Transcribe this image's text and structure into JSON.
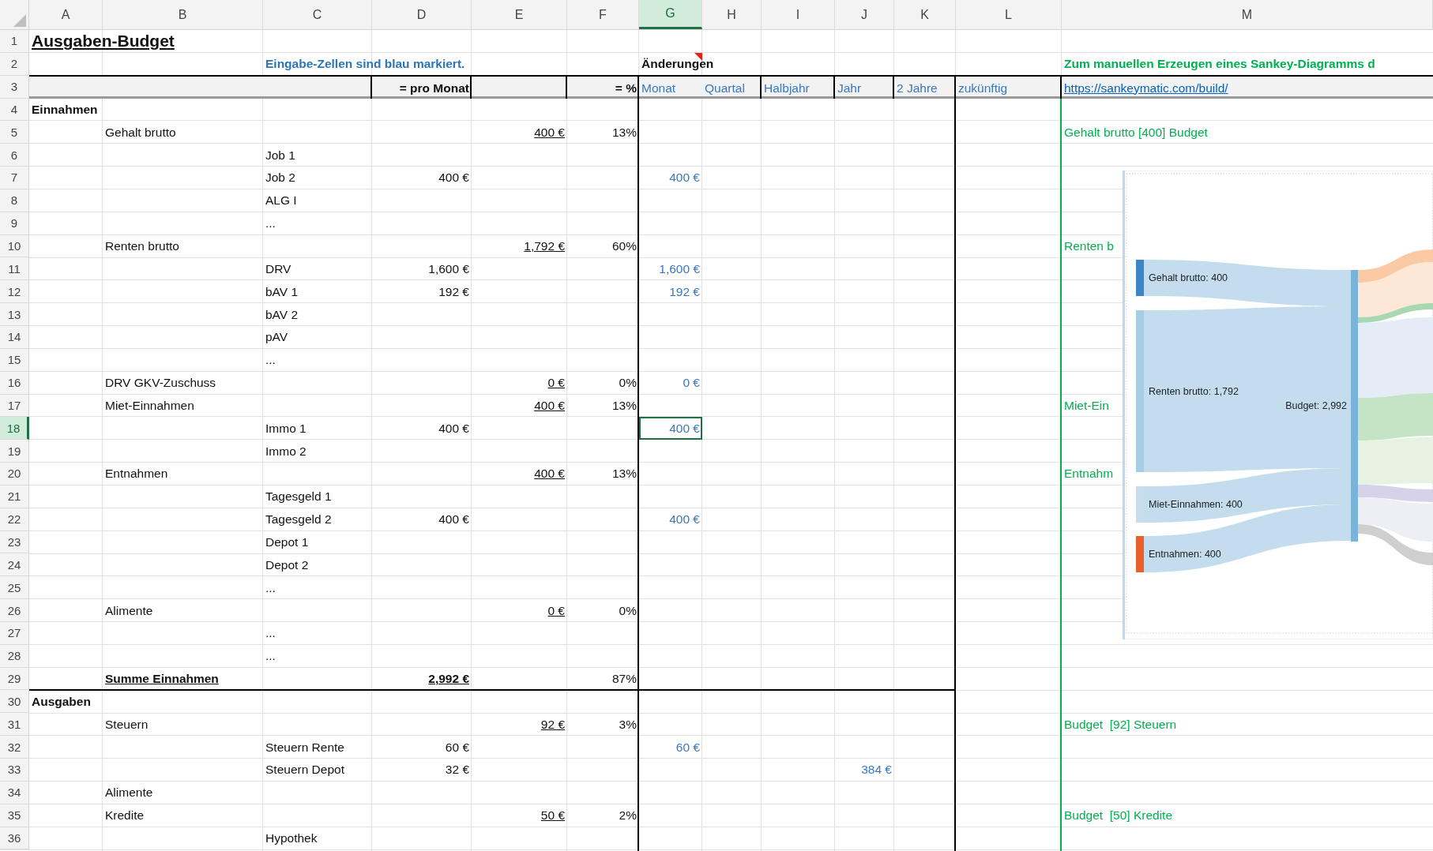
{
  "columns": [
    {
      "label": "A",
      "selected": false
    },
    {
      "label": "B",
      "selected": false
    },
    {
      "label": "C",
      "selected": false
    },
    {
      "label": "D",
      "selected": false
    },
    {
      "label": "E",
      "selected": false
    },
    {
      "label": "F",
      "selected": false
    },
    {
      "label": "G",
      "selected": true
    },
    {
      "label": "H",
      "selected": false
    },
    {
      "label": "I",
      "selected": false
    },
    {
      "label": "J",
      "selected": false
    },
    {
      "label": "K",
      "selected": false
    },
    {
      "label": "L",
      "selected": false
    },
    {
      "label": "M",
      "selected": false
    }
  ],
  "rows": [
    {
      "label": "1",
      "selected": false,
      "cells": {
        "A": {
          "kind": "title",
          "text": "Ausgaben-Budget",
          "selected": false
        }
      }
    },
    {
      "label": "2",
      "selected": false,
      "cells": {
        "C": {
          "kind": "note",
          "text": "Eingabe-Zellen sind blau markiert.",
          "selected": false
        },
        "G": {
          "kind": "heading",
          "text": "Änderungen",
          "selected": false,
          "comment": true
        },
        "M": {
          "kind": "greenbold",
          "text": "Zum manuellen Erzeugen eines Sankey-Diagramms d",
          "selected": false
        }
      }
    },
    {
      "label": "3",
      "selected": false,
      "cells": {
        "D": {
          "kind": "header",
          "text": "= pro Monat",
          "selected": false
        },
        "F": {
          "kind": "header",
          "text": "= %",
          "selected": false
        },
        "G": {
          "kind": "period",
          "text": "Monat",
          "selected": false
        },
        "H": {
          "kind": "period",
          "text": "Quartal",
          "selected": false
        },
        "I": {
          "kind": "period",
          "text": "Halbjahr",
          "selected": false
        },
        "J": {
          "kind": "period",
          "text": "Jahr",
          "selected": false
        },
        "K": {
          "kind": "period",
          "text": "2 Jahre",
          "selected": false
        },
        "L": {
          "kind": "period",
          "text": "zukünftig",
          "selected": false
        },
        "M": {
          "kind": "link",
          "text": "https://sankeymatic.com/build/",
          "selected": false
        }
      }
    },
    {
      "label": "4",
      "selected": false,
      "cells": {
        "A": {
          "kind": "heading",
          "text": "Einnahmen",
          "selected": false
        }
      }
    },
    {
      "label": "5",
      "selected": false,
      "cells": {
        "B": {
          "kind": "label",
          "text": "Gehalt brutto",
          "selected": false
        },
        "E": {
          "kind": "sum",
          "text": "400 €",
          "selected": false
        },
        "F": {
          "kind": "pct",
          "text": "13%",
          "selected": false
        },
        "M": {
          "kind": "green",
          "text": "Gehalt brutto [400] Budget",
          "selected": false
        }
      }
    },
    {
      "label": "6",
      "selected": false,
      "cells": {
        "C": {
          "kind": "label",
          "text": "Job 1",
          "selected": false
        }
      }
    },
    {
      "label": "7",
      "selected": false,
      "cells": {
        "C": {
          "kind": "label",
          "text": "Job 2",
          "selected": false
        },
        "D": {
          "kind": "amount",
          "text": "400 €",
          "selected": false
        },
        "G": {
          "kind": "input",
          "text": "400 €",
          "selected": false
        }
      }
    },
    {
      "label": "8",
      "selected": false,
      "cells": {
        "C": {
          "kind": "label",
          "text": "ALG I",
          "selected": false
        }
      }
    },
    {
      "label": "9",
      "selected": false,
      "cells": {
        "C": {
          "kind": "label",
          "text": "...",
          "selected": false
        }
      }
    },
    {
      "label": "10",
      "selected": false,
      "cells": {
        "B": {
          "kind": "label",
          "text": "Renten brutto",
          "selected": false
        },
        "E": {
          "kind": "sum",
          "text": "1,792 €",
          "selected": false
        },
        "F": {
          "kind": "pct",
          "text": "60%",
          "selected": false
        },
        "M": {
          "kind": "green",
          "text": "Renten b",
          "selected": false
        }
      }
    },
    {
      "label": "11",
      "selected": false,
      "cells": {
        "C": {
          "kind": "label",
          "text": "DRV",
          "selected": false
        },
        "D": {
          "kind": "amount",
          "text": "1,600 €",
          "selected": false
        },
        "G": {
          "kind": "input",
          "text": "1,600 €",
          "selected": false
        }
      }
    },
    {
      "label": "12",
      "selected": false,
      "cells": {
        "C": {
          "kind": "label",
          "text": "bAV 1",
          "selected": false
        },
        "D": {
          "kind": "amount",
          "text": "192 €",
          "selected": false
        },
        "G": {
          "kind": "input",
          "text": "192 €",
          "selected": false
        }
      }
    },
    {
      "label": "13",
      "selected": false,
      "cells": {
        "C": {
          "kind": "label",
          "text": "bAV 2",
          "selected": false
        }
      }
    },
    {
      "label": "14",
      "selected": false,
      "cells": {
        "C": {
          "kind": "label",
          "text": "pAV",
          "selected": false
        }
      }
    },
    {
      "label": "15",
      "selected": false,
      "cells": {
        "C": {
          "kind": "label",
          "text": "...",
          "selected": false
        }
      }
    },
    {
      "label": "16",
      "selected": false,
      "cells": {
        "B": {
          "kind": "label",
          "text": "DRV GKV-Zuschuss",
          "selected": false
        },
        "E": {
          "kind": "sum",
          "text": "0 €",
          "selected": false
        },
        "F": {
          "kind": "pct",
          "text": "0%",
          "selected": false
        },
        "G": {
          "kind": "input",
          "text": "0 €",
          "selected": false
        }
      }
    },
    {
      "label": "17",
      "selected": false,
      "cells": {
        "B": {
          "kind": "label",
          "text": "Miet-Einnahmen",
          "selected": false
        },
        "E": {
          "kind": "sum",
          "text": "400 €",
          "selected": false
        },
        "F": {
          "kind": "pct",
          "text": "13%",
          "selected": false
        },
        "M": {
          "kind": "green",
          "text": "Miet-Ein",
          "selected": false
        }
      }
    },
    {
      "label": "18",
      "selected": true,
      "cells": {
        "C": {
          "kind": "label",
          "text": "Immo 1",
          "selected": false
        },
        "D": {
          "kind": "amount",
          "text": "400 €",
          "selected": false
        },
        "G": {
          "kind": "input",
          "text": "400 €",
          "selected": true
        }
      }
    },
    {
      "label": "19",
      "selected": false,
      "cells": {
        "C": {
          "kind": "label",
          "text": "Immo 2",
          "selected": false
        }
      }
    },
    {
      "label": "20",
      "selected": false,
      "cells": {
        "B": {
          "kind": "label",
          "text": "Entnahmen",
          "selected": false
        },
        "E": {
          "kind": "sum",
          "text": "400 €",
          "selected": false
        },
        "F": {
          "kind": "pct",
          "text": "13%",
          "selected": false
        },
        "M": {
          "kind": "green",
          "text": "Entnahm",
          "selected": false
        }
      }
    },
    {
      "label": "21",
      "selected": false,
      "cells": {
        "C": {
          "kind": "label",
          "text": "Tagesgeld 1",
          "selected": false
        }
      }
    },
    {
      "label": "22",
      "selected": false,
      "cells": {
        "C": {
          "kind": "label",
          "text": "Tagesgeld 2",
          "selected": false
        },
        "D": {
          "kind": "amount",
          "text": "400 €",
          "selected": false
        },
        "G": {
          "kind": "input",
          "text": "400 €",
          "selected": false
        }
      }
    },
    {
      "label": "23",
      "selected": false,
      "cells": {
        "C": {
          "kind": "label",
          "text": "Depot 1",
          "selected": false
        }
      }
    },
    {
      "label": "24",
      "selected": false,
      "cells": {
        "C": {
          "kind": "label",
          "text": "Depot 2",
          "selected": false
        }
      }
    },
    {
      "label": "25",
      "selected": false,
      "cells": {
        "C": {
          "kind": "label",
          "text": "...",
          "selected": false
        }
      }
    },
    {
      "label": "26",
      "selected": false,
      "cells": {
        "B": {
          "kind": "label",
          "text": "Alimente",
          "selected": false
        },
        "E": {
          "kind": "sum",
          "text": "0 €",
          "selected": false
        },
        "F": {
          "kind": "pct",
          "text": "0%",
          "selected": false
        }
      }
    },
    {
      "label": "27",
      "selected": false,
      "cells": {
        "C": {
          "kind": "label",
          "text": "...",
          "selected": false
        }
      }
    },
    {
      "label": "28",
      "selected": false,
      "cells": {
        "C": {
          "kind": "label",
          "text": "...",
          "selected": false
        }
      }
    },
    {
      "label": "29",
      "selected": false,
      "cells": {
        "B": {
          "kind": "totallabel",
          "text": "Summe Einnahmen",
          "selected": false
        },
        "D": {
          "kind": "total",
          "text": "2,992 €",
          "selected": false
        },
        "F": {
          "kind": "pct",
          "text": "87%",
          "selected": false
        }
      }
    },
    {
      "label": "30",
      "selected": false,
      "cells": {
        "A": {
          "kind": "heading",
          "text": "Ausgaben",
          "selected": false
        }
      }
    },
    {
      "label": "31",
      "selected": false,
      "cells": {
        "B": {
          "kind": "label",
          "text": "Steuern",
          "selected": false
        },
        "E": {
          "kind": "sum",
          "text": "92 €",
          "selected": false
        },
        "F": {
          "kind": "pct",
          "text": "3%",
          "selected": false
        },
        "M": {
          "kind": "green",
          "text": "Budget  [92] Steuern",
          "selected": false
        }
      }
    },
    {
      "label": "32",
      "selected": false,
      "cells": {
        "C": {
          "kind": "label",
          "text": "Steuern Rente",
          "selected": false
        },
        "D": {
          "kind": "amount",
          "text": "60 €",
          "selected": false
        },
        "G": {
          "kind": "input",
          "text": "60 €",
          "selected": false
        }
      }
    },
    {
      "label": "33",
      "selected": false,
      "cells": {
        "C": {
          "kind": "label",
          "text": "Steuern Depot",
          "selected": false
        },
        "D": {
          "kind": "amount",
          "text": "32 €",
          "selected": false
        },
        "J": {
          "kind": "input",
          "text": "384 €",
          "selected": false
        }
      }
    },
    {
      "label": "34",
      "selected": false,
      "cells": {
        "B": {
          "kind": "label",
          "text": "Alimente",
          "selected": false
        }
      }
    },
    {
      "label": "35",
      "selected": false,
      "cells": {
        "B": {
          "kind": "label",
          "text": "Kredite",
          "selected": false
        },
        "E": {
          "kind": "sum",
          "text": "50 €",
          "selected": false
        },
        "F": {
          "kind": "pct",
          "text": "2%",
          "selected": false
        },
        "M": {
          "kind": "green",
          "text": "Budget  [50] Kredite",
          "selected": false
        }
      }
    },
    {
      "label": "36",
      "selected": false,
      "cells": {
        "C": {
          "kind": "label",
          "text": "Hypothek",
          "selected": false
        }
      }
    }
  ],
  "sankey": {
    "sources": [
      {
        "label": "Gehalt brutto: 400",
        "color": "#3d85c6"
      },
      {
        "label": "Renten brutto: 1,792",
        "color": "#a5cde3"
      },
      {
        "label": "Miet-Einnahmen: 400",
        "color": "#c9dcee"
      },
      {
        "label": "Entnahmen: 400",
        "color": "#e8612a"
      }
    ],
    "target": {
      "label": "Budget: 2,992"
    }
  }
}
